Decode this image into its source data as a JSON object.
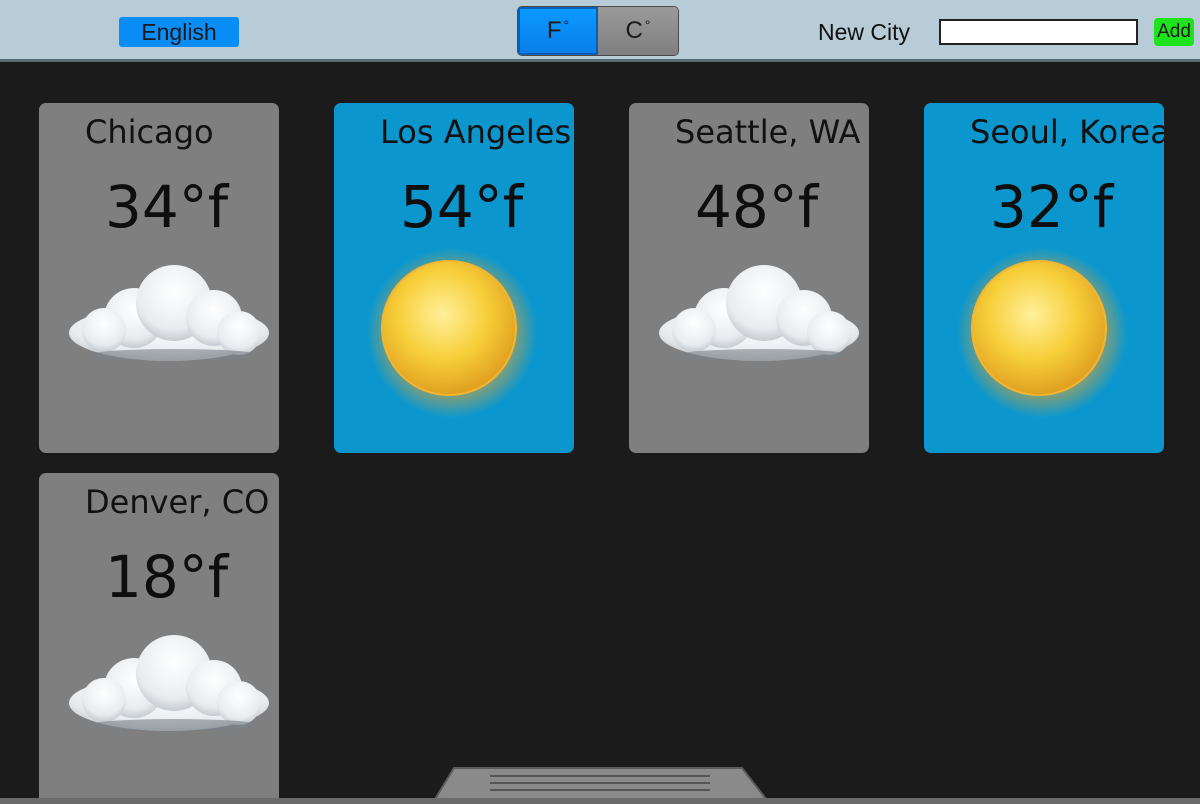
{
  "header": {
    "language_label": "English",
    "units": [
      {
        "label": "F",
        "degree": "°",
        "active": true
      },
      {
        "label": "C",
        "degree": "°",
        "active": false
      }
    ],
    "new_city_label": "New City",
    "new_city_value": "",
    "add_label": "Add"
  },
  "cities": [
    {
      "name": "Chicago",
      "temp": "34°f",
      "condition": "cloud-icon"
    },
    {
      "name": "Los Angeles",
      "temp": "54°f",
      "condition": "sun-icon"
    },
    {
      "name": "Seattle, WA",
      "temp": "48°f",
      "condition": "cloud-icon"
    },
    {
      "name": "Seoul, Korea",
      "temp": "32°f",
      "condition": "sun-icon"
    },
    {
      "name": "Denver, CO",
      "temp": "18°f",
      "condition": "cloud-icon"
    }
  ],
  "colors": {
    "topbar": "#b7ccd6",
    "accent_blue": "#0a8df6",
    "add_green": "#1de31d",
    "card_cloudy": "#7f7f7f",
    "card_sunny": "#0b97ce",
    "background": "#1b1b1b"
  }
}
